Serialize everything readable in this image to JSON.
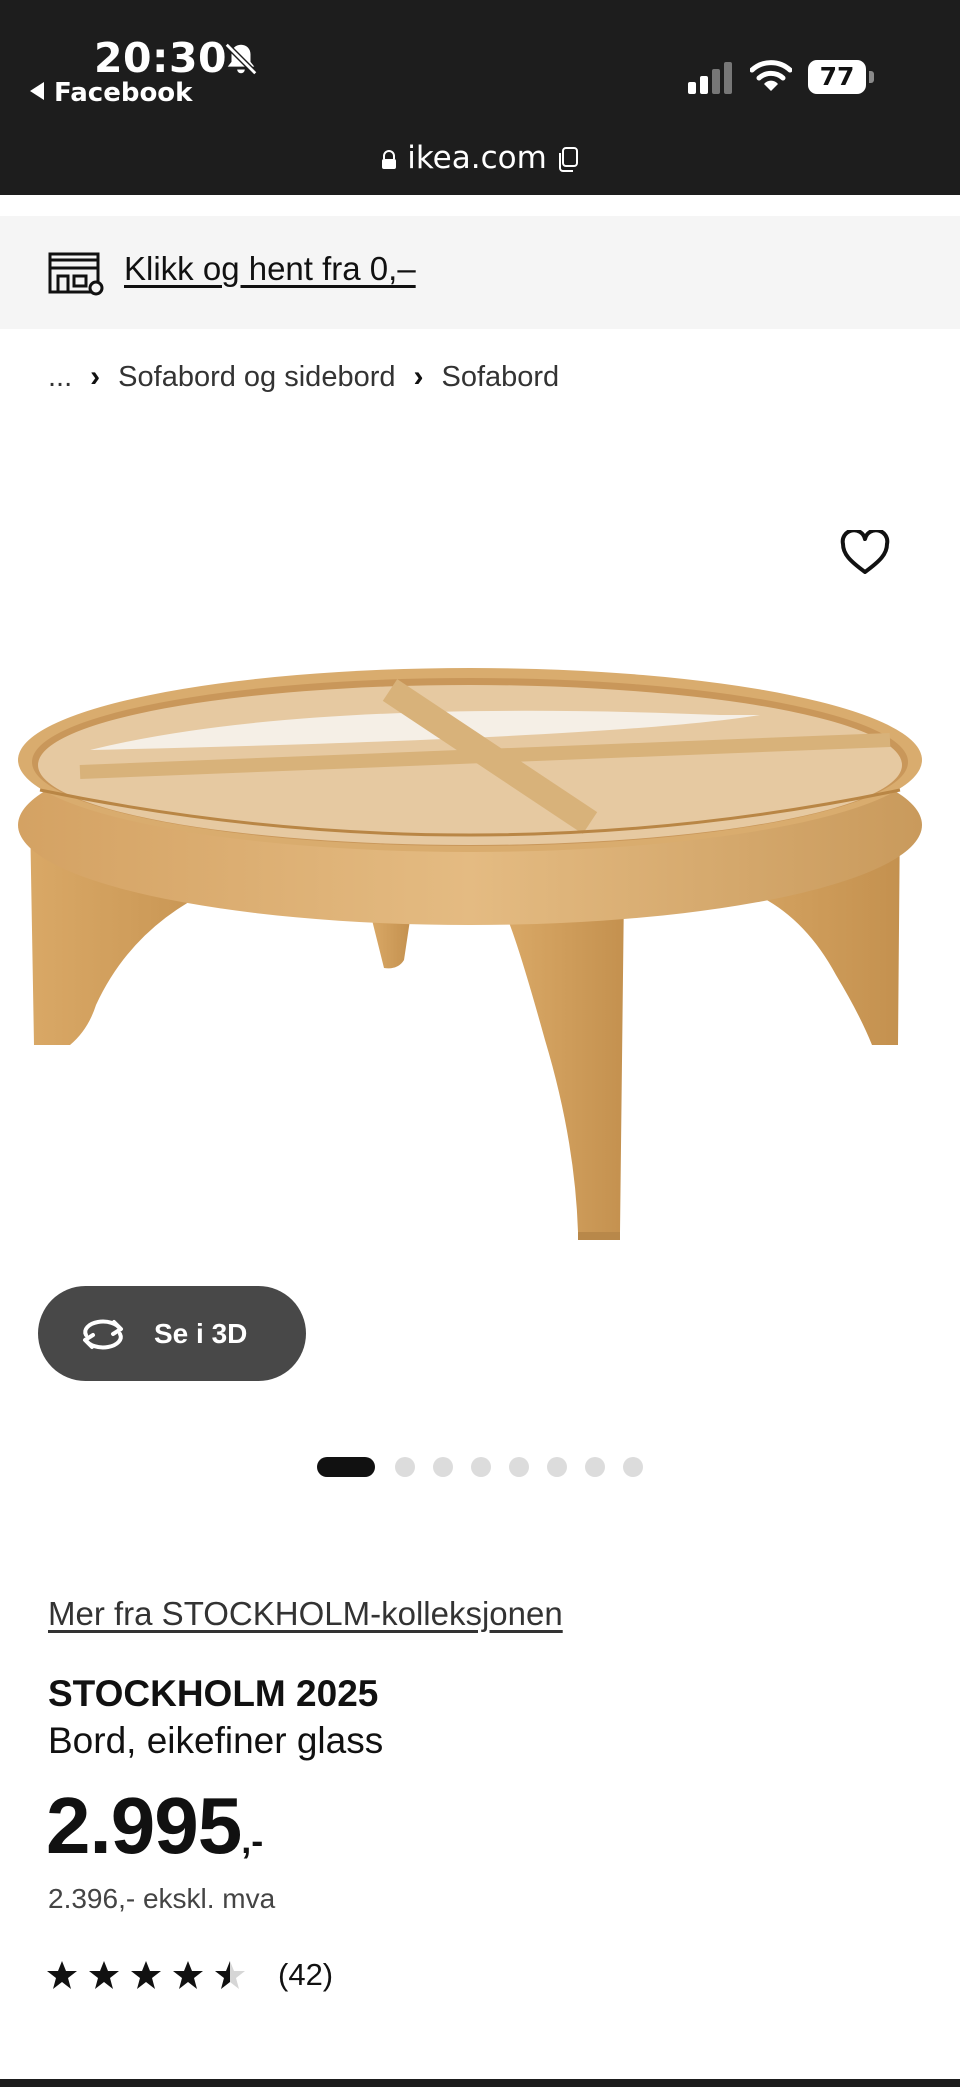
{
  "status_bar": {
    "time": "20:30",
    "back_app": "Facebook",
    "battery": "77",
    "icons": [
      "bell-muted-icon",
      "signal-icon",
      "wifi-icon",
      "battery-icon"
    ]
  },
  "browser": {
    "url": "ikea.com",
    "icons": [
      "lock-icon",
      "copy-icon"
    ]
  },
  "promo": {
    "link_text": "Klikk og hent fra 0,–",
    "icon": "store-pickup-icon"
  },
  "breadcrumb": {
    "ellipsis": "...",
    "items": [
      "Sofabord og sidebord",
      "Sofabord"
    ]
  },
  "gallery": {
    "favorite_icon": "heart-icon",
    "view_3d_label": "Se i 3D",
    "image_count": 8,
    "active_index": 0
  },
  "product": {
    "collection_link": "Mer fra STOCKHOLM-kolleksjonen",
    "name": "STOCKHOLM 2025",
    "description": "Bord, eikefiner glass",
    "price": "2.995",
    "price_suffix": ",-",
    "price_ex_vat": "2.396,- ekskl. mva",
    "rating": 4.5,
    "review_count": "(42)"
  },
  "colors": {
    "status_bar_bg": "#1d1d1d",
    "promo_bg": "#f5f5f5",
    "button_3d_bg": "#484848",
    "dot_active": "#111111",
    "dot_inactive": "#dcdcdc"
  }
}
